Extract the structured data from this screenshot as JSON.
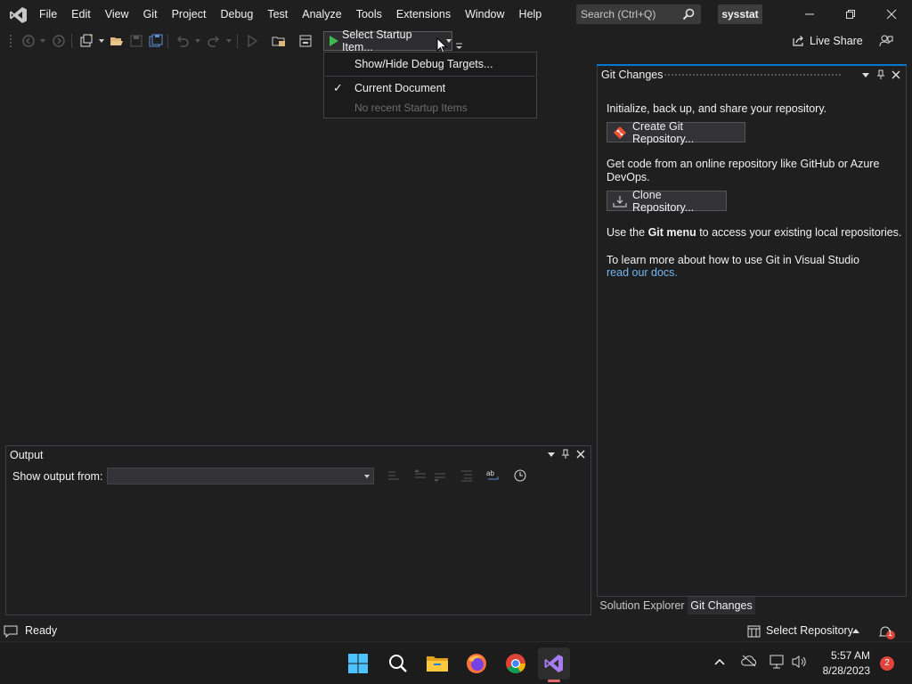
{
  "menu": {
    "items": [
      "File",
      "Edit",
      "View",
      "Git",
      "Project",
      "Debug",
      "Test",
      "Analyze",
      "Tools",
      "Extensions",
      "Window",
      "Help"
    ]
  },
  "search": {
    "placeholder": "Search (Ctrl+Q)"
  },
  "solution": {
    "name": "sysstat"
  },
  "toolbar": {
    "startup_label": "Select Startup Item...",
    "live_share": "Live Share"
  },
  "startup_dropdown": {
    "show_hide": "Show/Hide Debug Targets...",
    "current_document": "Current Document",
    "current_document_checkmark": "✓",
    "no_recent": "No recent Startup Items"
  },
  "git_changes": {
    "title": "Git Changes",
    "init_text": "Initialize, back up, and share your repository.",
    "create_button": "Create Git Repository...",
    "clone_text_1": "Get code from an online repository like GitHub or Azure",
    "clone_text_2": "DevOps.",
    "clone_button": "Clone Repository...",
    "menu_text_pre": "Use the ",
    "menu_text_bold": "Git menu",
    "menu_text_post": " to access your existing local repositories.",
    "learn_text": "To learn more about how to use Git in Visual Studio",
    "docs_link": "read our docs."
  },
  "right_tabs": {
    "solution_explorer": "Solution Explorer",
    "git_changes": "Git Changes"
  },
  "output": {
    "title": "Output",
    "show_from_label": "Show output from:",
    "source_value": ""
  },
  "status": {
    "ready": "Ready",
    "select_repository": "Select Repository"
  },
  "taskbar": {
    "time": "5:57 AM",
    "date": "8/28/2023",
    "notification_count": "2",
    "vs_notification_count": "1"
  },
  "colors": {
    "accent": "#0078d4",
    "vs_purple": "#a77bf3",
    "link": "#72b6f2",
    "play_green": "#3fba50",
    "badge_red": "#e0443b"
  }
}
